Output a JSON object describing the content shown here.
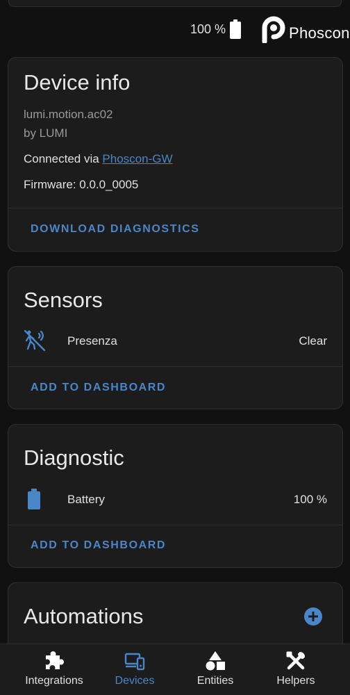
{
  "header": {
    "battery_text": "100 %",
    "logo_text": "Phoscon",
    "icons": {
      "battery": "battery-full-icon",
      "logo": "phoscon-logo-icon"
    }
  },
  "device_info": {
    "title": "Device info",
    "model": "lumi.motion.ac02",
    "manufacturer": "by LUMI",
    "connected_prefix": "Connected via ",
    "connected_link": "Phoscon-GW",
    "firmware": "Firmware: 0.0.0_0005",
    "action": "DOWNLOAD DIAGNOSTICS"
  },
  "sensors": {
    "title": "Sensors",
    "rows": [
      {
        "label": "Presenza",
        "value": "Clear",
        "icon": "motion-sensor-icon"
      }
    ],
    "action": "ADD TO DASHBOARD"
  },
  "diagnostic": {
    "title": "Diagnostic",
    "rows": [
      {
        "label": "Battery",
        "value": "100 %",
        "icon": "battery-icon"
      }
    ],
    "action": "ADD TO DASHBOARD"
  },
  "automations": {
    "title": "Automations",
    "add_icon": "plus-circle-icon"
  },
  "bottom_nav": {
    "items": [
      {
        "label": "Integrations",
        "icon": "puzzle-icon",
        "active": false
      },
      {
        "label": "Devices",
        "icon": "devices-icon",
        "active": true
      },
      {
        "label": "Entities",
        "icon": "shapes-icon",
        "active": false
      },
      {
        "label": "Helpers",
        "icon": "tools-icon",
        "active": false
      }
    ]
  },
  "colors": {
    "background": "#111111",
    "card": "#1c1c1c",
    "accent": "#4b86c8",
    "text": "#e1e1e1",
    "secondary_text": "#9a9a9a"
  }
}
